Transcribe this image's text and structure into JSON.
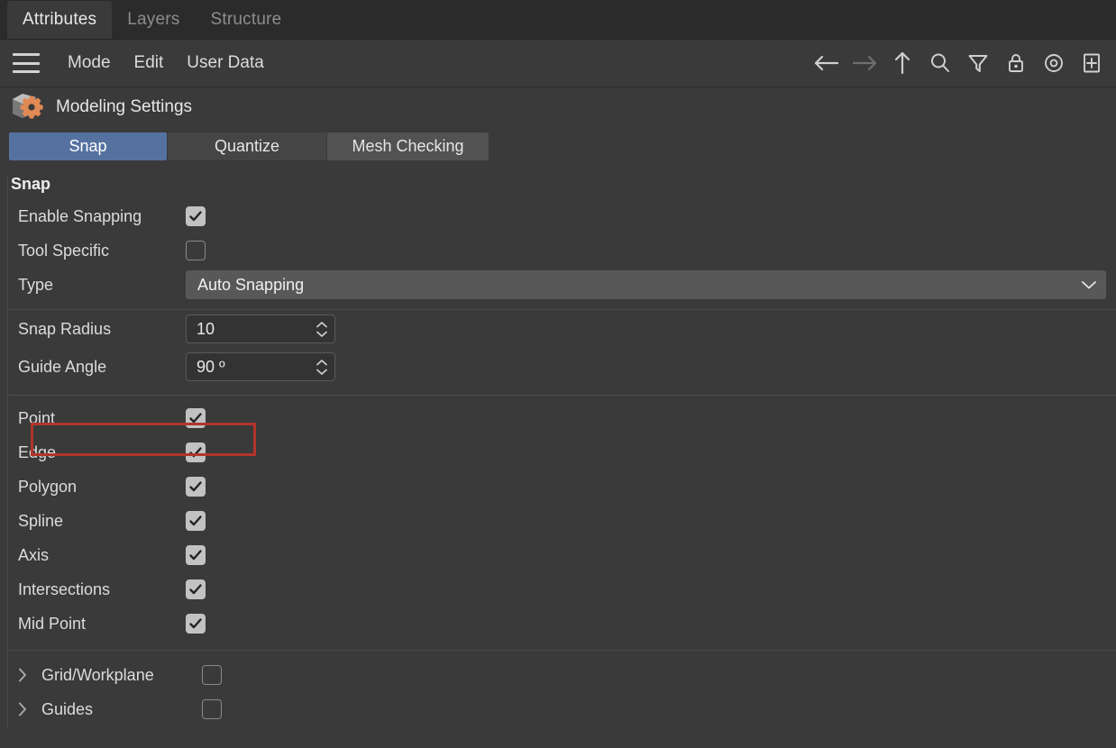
{
  "window": {
    "tabs": [
      {
        "label": "Attributes",
        "active": true
      },
      {
        "label": "Layers",
        "active": false
      },
      {
        "label": "Structure",
        "active": false
      }
    ]
  },
  "menubar": {
    "hamburger_icon": "hamburger-menu-icon",
    "items": [
      "Mode",
      "Edit",
      "User Data"
    ],
    "tool_icons": [
      "arrow-left-icon",
      "arrow-right-icon",
      "arrow-up-icon",
      "search-icon",
      "filter-funnel-icon",
      "lock-icon",
      "record-circle-icon",
      "add-box-icon"
    ]
  },
  "header": {
    "icon": "cube-gear-icon",
    "title": "Modeling Settings"
  },
  "section_tabs": [
    {
      "label": "Snap",
      "selected": true
    },
    {
      "label": "Quantize",
      "selected": false
    },
    {
      "label": "Mesh Checking",
      "selected": false
    }
  ],
  "snap": {
    "group_title": "Snap",
    "enable_snapping": {
      "label": "Enable Snapping",
      "checked": true
    },
    "tool_specific": {
      "label": "Tool Specific",
      "checked": false,
      "highlighted": true
    },
    "type": {
      "label": "Type",
      "value": "Auto Snapping",
      "chevron": "chevron-down-icon"
    },
    "snap_radius": {
      "label": "Snap Radius",
      "value": "10"
    },
    "guide_angle": {
      "label": "Guide Angle",
      "value": "90 º"
    },
    "targets": [
      {
        "label": "Point",
        "checked": true
      },
      {
        "label": "Edge",
        "checked": true
      },
      {
        "label": "Polygon",
        "checked": true
      },
      {
        "label": "Spline",
        "checked": true
      },
      {
        "label": "Axis",
        "checked": true
      },
      {
        "label": "Intersections",
        "checked": true
      },
      {
        "label": "Mid Point",
        "checked": true
      }
    ],
    "groups": [
      {
        "label": "Grid/Workplane",
        "checked": false,
        "expander": "chevron-right-icon"
      },
      {
        "label": "Guides",
        "checked": false,
        "expander": "chevron-right-icon"
      }
    ]
  },
  "colors": {
    "panel_bg": "#3a3a3a",
    "topbar_bg": "#2b2b2b",
    "accent_blue": "#5571a0",
    "highlight_red": "#b3342b",
    "field_bg": "#585858",
    "gear_orange": "#e08a55"
  }
}
